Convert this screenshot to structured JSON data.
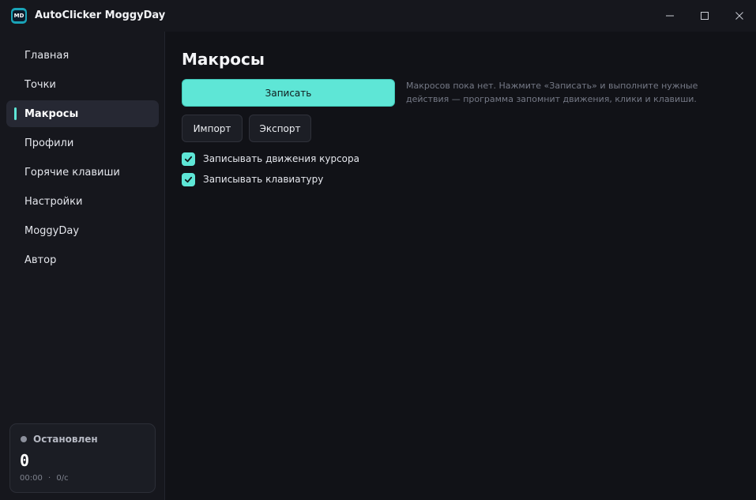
{
  "app": {
    "title": "AutoClicker MoggyDay",
    "logo_text": "MD",
    "accent_color": "#5ee6d6"
  },
  "window_controls": {
    "minimize_icon": "minimize-icon",
    "maximize_icon": "maximize-icon",
    "close_icon": "close-icon"
  },
  "sidebar": {
    "items": [
      {
        "label": "Главная",
        "active": false
      },
      {
        "label": "Точки",
        "active": false
      },
      {
        "label": "Макросы",
        "active": true
      },
      {
        "label": "Профили",
        "active": false
      },
      {
        "label": "Горячие клавиши",
        "active": false
      },
      {
        "label": "Настройки",
        "active": false
      },
      {
        "label": "MoggyDay",
        "active": false
      },
      {
        "label": "Автор",
        "active": false
      }
    ],
    "status": {
      "label": "Остановлен",
      "count": "0",
      "time": "00:00",
      "separator": "·",
      "rate": "0/с"
    }
  },
  "main": {
    "title": "Макросы",
    "record_label": "Записать",
    "hint": "Макросов пока нет. Нажмите «Записать» и выполните нужные действия — программа запомнит движения, клики и клавиши.",
    "import_label": "Импорт",
    "export_label": "Экспорт",
    "options": [
      {
        "label": "Записывать движения курсора",
        "checked": true
      },
      {
        "label": "Записывать клавиатуру",
        "checked": true
      }
    ]
  }
}
